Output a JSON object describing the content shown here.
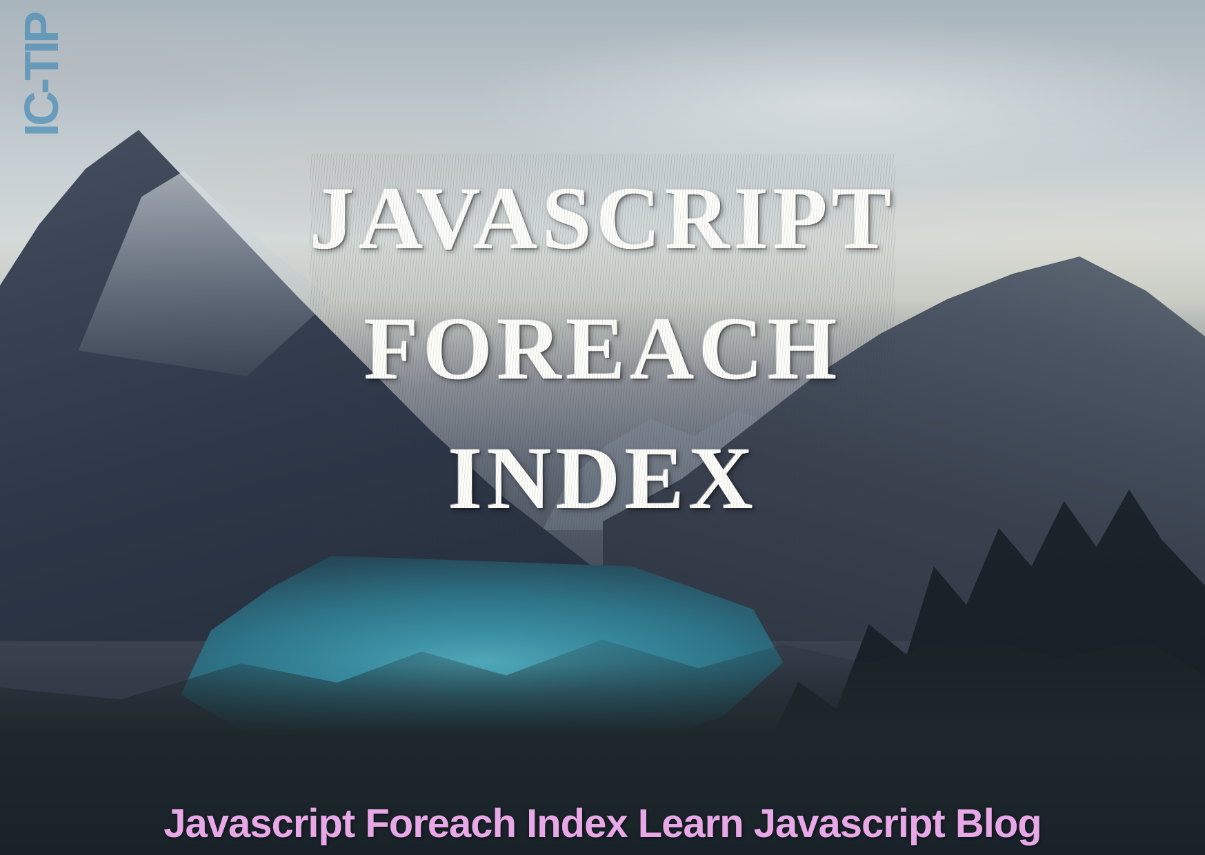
{
  "watermark": "IC-TIP",
  "hero": {
    "line1": "JAVASCRIPT",
    "line2": "FOREACH",
    "line3": "INDEX"
  },
  "caption": "Javascript Foreach Index Learn Javascript Blog"
}
